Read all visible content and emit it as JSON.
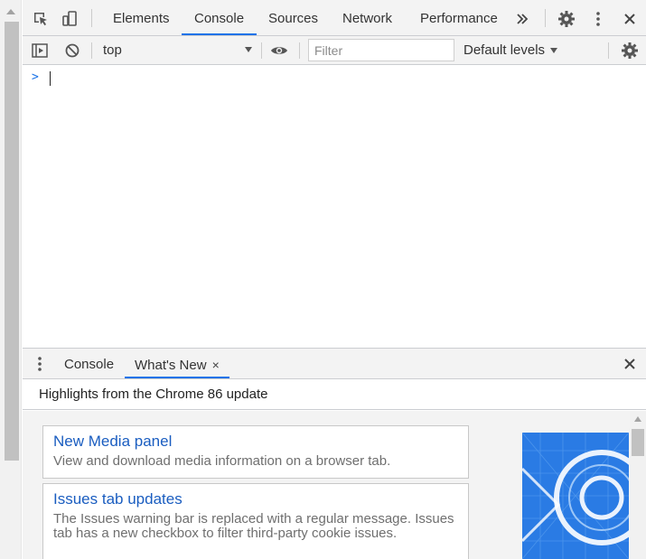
{
  "main_tabs": {
    "items": [
      "Elements",
      "Console",
      "Sources",
      "Network",
      "Performance"
    ],
    "active": "Console",
    "overflow_icon": "chevron-double-right-icon"
  },
  "console_toolbar": {
    "context": "top",
    "filter_placeholder": "Filter",
    "levels": "Default levels"
  },
  "console": {
    "prompt_symbol": ">"
  },
  "drawer": {
    "tabs": [
      "Console",
      "What's New"
    ],
    "active": "What's New",
    "tab_close_symbol": "×",
    "highlights": "Highlights from the Chrome 86 update",
    "cards": [
      {
        "title": "New Media panel",
        "description": "View and download media information on a browser tab."
      },
      {
        "title": "Issues tab updates",
        "description": "The Issues warning bar is replaced with a regular message. Issues tab has a new checkbox to filter third-party cookie issues."
      }
    ]
  },
  "colors": {
    "accent": "#1a73e8",
    "toolbar_bg": "#f3f3f3",
    "link": "#1a5dc0",
    "hero": "#2a7be4"
  }
}
